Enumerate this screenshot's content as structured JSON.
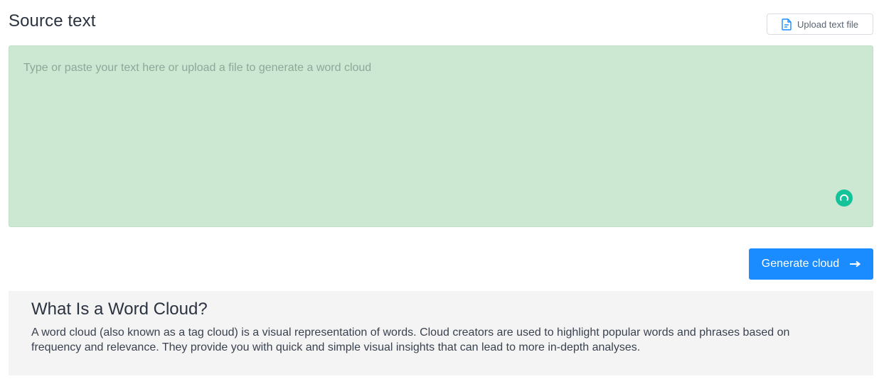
{
  "source": {
    "title": "Source text",
    "upload_label": "Upload text file",
    "upload_icon": "document-icon",
    "textarea_placeholder": "Type or paste your text here or upload a file to generate a word cloud",
    "textarea_value": "",
    "textarea_bg": "#cde8d2",
    "badge_icon": "grammar-assistant-icon",
    "badge_color": "#15c39a"
  },
  "actions": {
    "generate_label": "Generate cloud",
    "generate_icon": "arrow-right-icon",
    "generate_color": "#1a8cff"
  },
  "info": {
    "title": "What Is a Word Cloud?",
    "body": "A word cloud (also known as a tag cloud) is a visual representation of words. Cloud creators are used to highlight popular words and phrases based on frequency and relevance. They provide you with quick and simple visual insights that can lead to more in-depth analyses."
  }
}
